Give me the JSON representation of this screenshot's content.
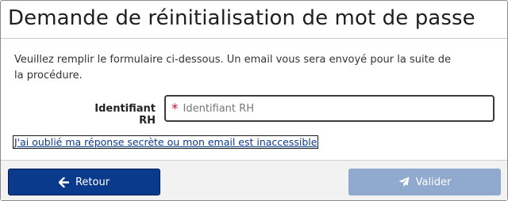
{
  "dialog": {
    "title": "Demande de réinitialisation de mot de passe",
    "intro": "Veuillez remplir le formulaire ci-dessous. Un email vous sera envoyé pour la suite de la procédure."
  },
  "form": {
    "hr_id": {
      "label": "Identifiant RH",
      "required_marker": "*",
      "placeholder": "Identifiant RH",
      "value": ""
    },
    "forgot_link": "J'ai oublié ma réponse secrète ou mon email est inaccessible"
  },
  "footer": {
    "back_label": "Retour",
    "back_icon": "arrow-left-icon",
    "validate_label": "Valider",
    "validate_icon": "paper-plane-icon",
    "validate_enabled": false
  },
  "colors": {
    "primary": "#0a3a8c",
    "primary_disabled": "#8fa9cf",
    "required": "#c0152f"
  }
}
